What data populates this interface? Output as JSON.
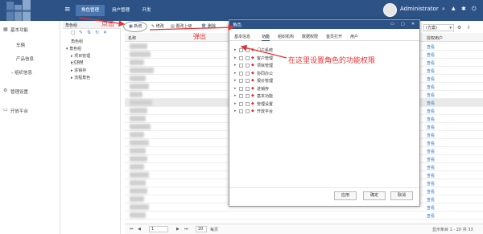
{
  "topbar": {
    "menu_icon": "≡",
    "tabs": [
      "角色管理",
      "用户管理",
      "开发"
    ],
    "admin": "Administrator",
    "icons": {
      "search": "⌕",
      "bell": "▲",
      "settings": "✱",
      "power": "⏻"
    }
  },
  "sidebar": {
    "groups": [
      "基本功能",
      "管理设置",
      "开放平台"
    ],
    "items": [
      "车辆",
      "产品信息",
      "› 组织信息"
    ]
  },
  "role_panel": {
    "header": "角色组",
    "col": "角色组",
    "tree": [
      "角色组",
      "项目管理",
      "CRM",
      "进销存",
      "流程角色"
    ]
  },
  "toolbar": {
    "new": "新增",
    "edit": "修改",
    "move_up": "置改上级",
    "delete": "删除"
  },
  "grid": {
    "col_name": "名称",
    "col_right": "授权用户",
    "dropdown": "(方案)",
    "link": "查看"
  },
  "pager": {
    "page": "1",
    "size": "20",
    "per": "每页",
    "summary": "显示条目 1 - 20 共 33"
  },
  "dialog": {
    "title": "角色",
    "tabs": [
      "基本信息",
      "功能",
      "组织机构",
      "数据权限",
      "首页打开",
      "用户"
    ],
    "functions": [
      "门户系统",
      "客户管理",
      "项目管理",
      "协同办公",
      "报价管理",
      "进销存",
      "基本功能",
      "管理设置",
      "开放平台"
    ],
    "buttons": {
      "apply": "应用",
      "ok": "确定",
      "cancel": "取消"
    }
  },
  "annotations": {
    "click": "点击",
    "popup": "弹出",
    "note": "在这里设置角色的功能权限"
  },
  "colors": {
    "header": "#2d5386",
    "annotation": "#e53333",
    "link": "#2d7bd5"
  }
}
